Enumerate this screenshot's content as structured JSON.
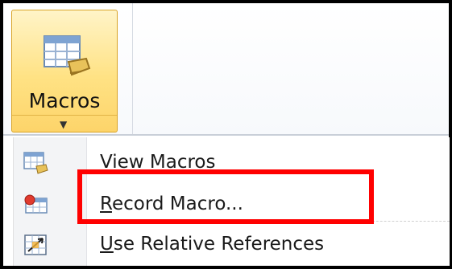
{
  "ribbon": {
    "macros_button": {
      "label": "Macros",
      "icon": "macros-table-icon",
      "caret": "chevron-down-icon",
      "state": "pressed"
    }
  },
  "menu": {
    "items": [
      {
        "label": "View Macros",
        "underline_char": "V",
        "rest": "iew Macros",
        "icon": "view-macros-icon"
      },
      {
        "label": "Record Macro...",
        "underline_char": "R",
        "rest": "ecord Macro...",
        "icon": "record-macro-icon"
      },
      {
        "label": "Use Relative References",
        "underline_char": "U",
        "rest": "se Relative References",
        "icon": "relative-references-icon"
      }
    ]
  },
  "annotation": {
    "highlighted_item": "Record Macro...",
    "color": "#ff0000"
  },
  "colors": {
    "button_fill": "#ffe284",
    "button_border": "#d9a326",
    "menu_gutter": "#f3f4f6"
  }
}
